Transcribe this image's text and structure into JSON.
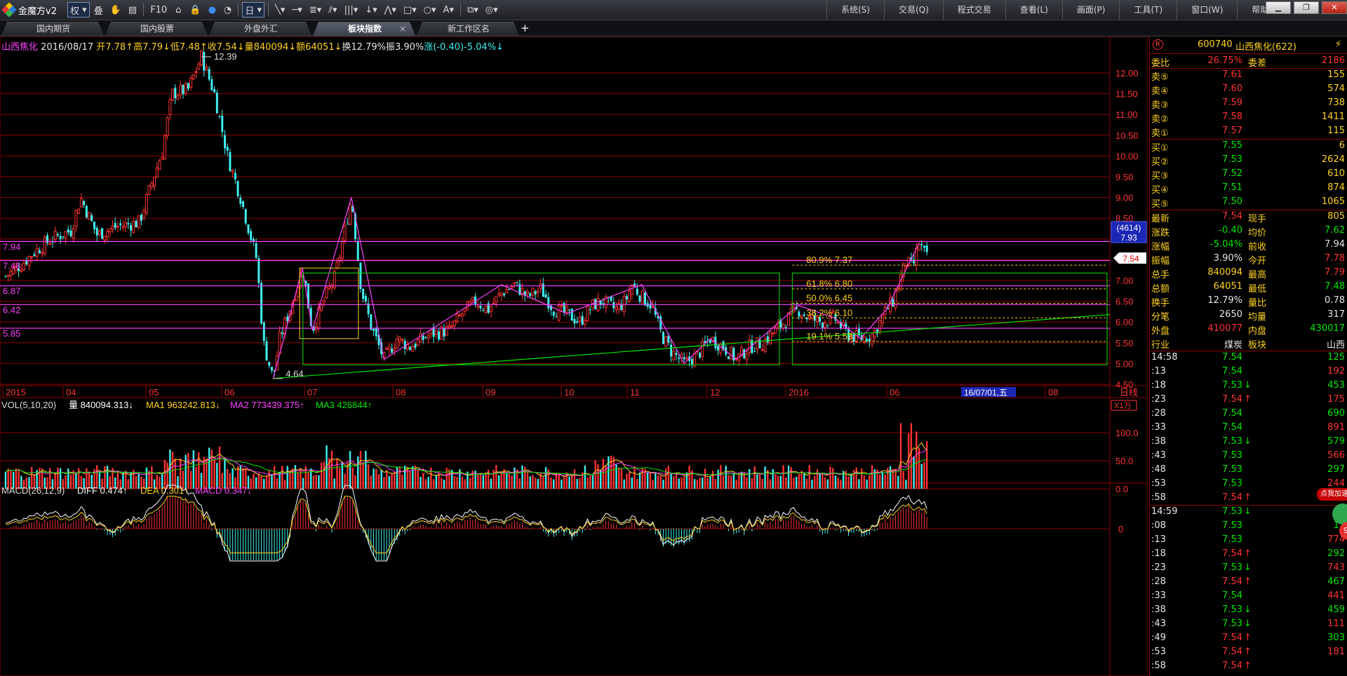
{
  "app": {
    "title": "金魔方v2",
    "menu": [
      "系统(S)",
      "交易(Q)",
      "程式交易",
      "查看(L)",
      "画面(P)",
      "工具(T)",
      "窗口(W)",
      "帮助(H)"
    ],
    "weight_select": "权",
    "period_select": "日",
    "f10_label": "F10"
  },
  "tabs": [
    "国内期货",
    "国内股票",
    "外盘外汇",
    "板块指数",
    "新工作区名"
  ],
  "active_tab": 3,
  "quote_line": {
    "name": "山西焦化",
    "date": "2016/08/17",
    "open": "开7.78↑",
    "high": "高7.79↓",
    "low": "低7.48↑",
    "close": "收7.54↓",
    "volume": "量840094↓",
    "amount": "额64051↓",
    "turnover": "换12.79%",
    "amplitude": "振3.90%",
    "change": "涨(-0.40)-5.04%↓"
  },
  "price_axis": [
    "12.00",
    "11.50",
    "11.00",
    "10.50",
    "10.00",
    "9.50",
    "9.00",
    "8.50",
    "8.00",
    "7.50",
    "7.00",
    "6.50",
    "6.00",
    "5.50",
    "5.00",
    "4.50"
  ],
  "price_box": {
    "count": "(4614)",
    "price": "7.93"
  },
  "last_price_tag": "7.54",
  "hlines": [
    "7.94",
    "7.48",
    "6.87",
    "6.42",
    "5.85"
  ],
  "annotations": {
    "high": "12.39",
    "low": "4.64"
  },
  "fibo": [
    "80.9% 7.37",
    "61.8% 6.80",
    "50.0% 6.45",
    "38.2% 6.10",
    "19.1% 5.53"
  ],
  "time_axis": [
    "2015",
    "04",
    "05",
    "06",
    "07",
    "08",
    "09",
    "10",
    "11",
    "12",
    "2016",
    "06",
    "08"
  ],
  "cursor_date": "16/07/01,五",
  "period_label": "日线",
  "vol_label": {
    "title": "VOL(5,10,20)",
    "vol": "量 840094.313↓",
    "ma1": "MA1 963242.813↓",
    "ma2": "MA2 773439.375↑",
    "ma3": "MA3 426844↑",
    "scale": "X1万"
  },
  "vol_axis": [
    "100.0",
    "50.0",
    "0.0"
  ],
  "macd_label": {
    "title": "MACD(26,12,9)",
    "diff": "DIFF 0.474↑",
    "dea": "DEA 0.301↑",
    "macd": "MACD 0.347↓"
  },
  "macd_axis": "0",
  "panel": {
    "header": {
      "code": "600740",
      "name": "山西焦化(622)"
    },
    "weibi": {
      "label": "委比",
      "value": "26.75%",
      "label2": "委差",
      "value2": "2186"
    },
    "sells": [
      {
        "label": "卖⑤",
        "price": "7.61",
        "vol": "155"
      },
      {
        "label": "卖④",
        "price": "7.60",
        "vol": "574"
      },
      {
        "label": "卖③",
        "price": "7.59",
        "vol": "738"
      },
      {
        "label": "卖②",
        "price": "7.58",
        "vol": "1411"
      },
      {
        "label": "卖①",
        "price": "7.57",
        "vol": "115"
      }
    ],
    "buys": [
      {
        "label": "买①",
        "price": "7.55",
        "vol": "6"
      },
      {
        "label": "买②",
        "price": "7.53",
        "vol": "2624"
      },
      {
        "label": "买③",
        "price": "7.52",
        "vol": "610"
      },
      {
        "label": "买④",
        "price": "7.51",
        "vol": "874"
      },
      {
        "label": "买⑤",
        "price": "7.50",
        "vol": "1065"
      }
    ],
    "stats": [
      {
        "l1": "最新",
        "v1": "7.54",
        "l2": "现手",
        "v2": "805"
      },
      {
        "l1": "涨跌",
        "v1": "-0.40",
        "l2": "均价",
        "v2": "7.62"
      },
      {
        "l1": "涨幅",
        "v1": "-5.04%",
        "l2": "前收",
        "v2": "7.94"
      },
      {
        "l1": "振幅",
        "v1": "3.90%",
        "l2": "今开",
        "v2": "7.78"
      },
      {
        "l1": "总手",
        "v1": "840094",
        "l2": "最高",
        "v2": "7.79"
      },
      {
        "l1": "总额",
        "v1": "64051",
        "l2": "最低",
        "v2": "7.48"
      },
      {
        "l1": "换手",
        "v1": "12.79%",
        "l2": "量比",
        "v2": "0.78"
      },
      {
        "l1": "分笔",
        "v1": "2650",
        "l2": "均量",
        "v2": "317"
      },
      {
        "l1": "外盘",
        "v1": "410077",
        "l2": "内盘",
        "v2": "430017"
      },
      {
        "l1": "行业",
        "v1": "煤炭",
        "l2": "板块",
        "v2": "山西"
      }
    ],
    "ticks": [
      {
        "t": "14:58",
        "p": "7.54",
        "a": "",
        "v": "125"
      },
      {
        "t": ":13",
        "p": "7.54",
        "a": "",
        "v": "192"
      },
      {
        "t": ":18",
        "p": "7.53",
        "a": "↓",
        "v": "453"
      },
      {
        "t": ":23",
        "p": "7.54",
        "a": "↑",
        "v": "175"
      },
      {
        "t": ":28",
        "p": "7.54",
        "a": "",
        "v": "690"
      },
      {
        "t": ":33",
        "p": "7.54",
        "a": "",
        "v": "891"
      },
      {
        "t": ":38",
        "p": "7.53",
        "a": "↓",
        "v": "579"
      },
      {
        "t": ":43",
        "p": "7.53",
        "a": "",
        "v": "566"
      },
      {
        "t": ":48",
        "p": "7.53",
        "a": "",
        "v": "297"
      },
      {
        "t": ":53",
        "p": "7.53",
        "a": "",
        "v": "244"
      },
      {
        "t": ":58",
        "p": "7.54",
        "a": "↑",
        "v": "56"
      },
      {
        "t": "14:59",
        "p": "7.53",
        "a": "↓",
        "v": "96"
      },
      {
        "t": ":08",
        "p": "7.53",
        "a": "",
        "v": "11"
      },
      {
        "t": ":13",
        "p": "7.53",
        "a": "",
        "v": "774"
      },
      {
        "t": ":18",
        "p": "7.54",
        "a": "↑",
        "v": "292"
      },
      {
        "t": ":23",
        "p": "7.53",
        "a": "↓",
        "v": "743"
      },
      {
        "t": ":28",
        "p": "7.54",
        "a": "↑",
        "v": "467"
      },
      {
        "t": ":33",
        "p": "7.54",
        "a": "",
        "v": "441"
      },
      {
        "t": ":38",
        "p": "7.53",
        "a": "↓",
        "v": "459"
      },
      {
        "t": ":43",
        "p": "7.53",
        "a": "↓",
        "v": "111"
      },
      {
        "t": ":49",
        "p": "7.54",
        "a": "↑",
        "v": "303"
      },
      {
        "t": ":53",
        "p": "7.54",
        "a": "↑",
        "v": "181"
      },
      {
        "t": ":58",
        "p": "7.54",
        "a": "↑",
        "v": ""
      }
    ],
    "badge": "点我加速",
    "badge_num": "92"
  },
  "colors": {
    "up": "#ff3232",
    "down": "#3ff0f0",
    "grid": "#8b0000",
    "magenta": "#ff40ff",
    "yellow": "#ffd21f",
    "green": "#00e600"
  }
}
